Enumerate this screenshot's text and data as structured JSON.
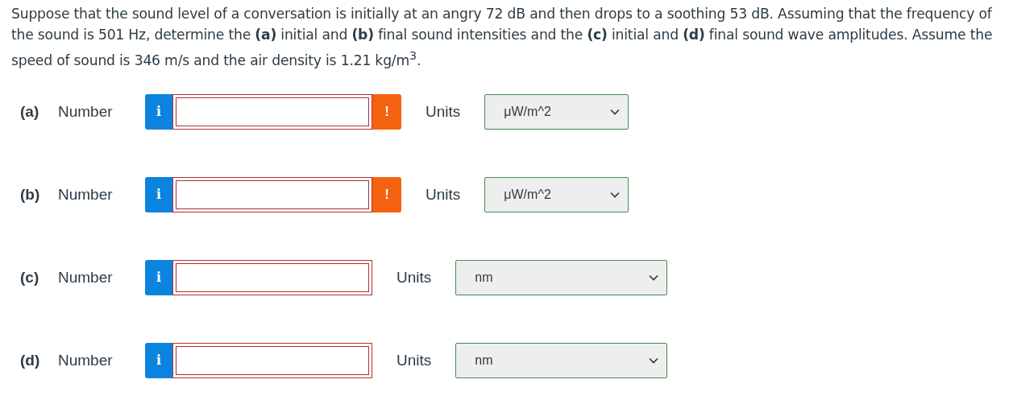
{
  "question": "Suppose that the sound level of a conversation is initially at an angry 72 dB and then drops to a soothing 53 dB. Assuming that the frequency of the sound is 501 Hz, determine the **(a)** initial and **(b)** final sound intensities and the **(c)** initial and **(d)** final sound wave amplitudes. Assume the speed of sound is 346 m/s and the air density is 1.21 kg/m$^{3}$.",
  "answers": [
    {
      "part": "(a)",
      "label": "Number",
      "info": "i",
      "warning": true,
      "warning_icon": "!",
      "units_label": "Units",
      "units": "μW/m^2"
    },
    {
      "part": "(b)",
      "label": "Number",
      "info": "i",
      "warning": true,
      "warning_icon": "!",
      "units_label": "Units",
      "units": "μW/m^2"
    },
    {
      "part": "(c)",
      "label": "Number",
      "info": "i",
      "warning": false,
      "units_label": "Units",
      "units": "nm"
    },
    {
      "part": "(d)",
      "label": "Number",
      "info": "i",
      "warning": false,
      "units_label": "Units",
      "units": "nm"
    }
  ]
}
